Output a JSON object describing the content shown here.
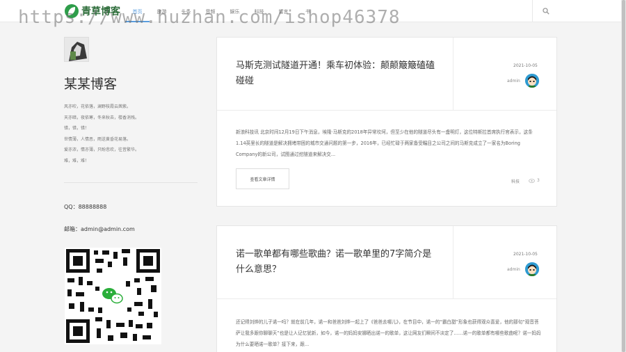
{
  "site": {
    "logo_text": "青草博客"
  },
  "nav": {
    "items": [
      "首页",
      "旅游",
      "头条",
      "音频",
      "娱乐",
      "科技",
      "留言",
      "书"
    ]
  },
  "icons": {
    "search": "search-icon",
    "views": "eye-icon",
    "logo": "leaf-logo-icon"
  },
  "colors": {
    "accent": "#5a9dde",
    "brand_green": "#2e9d4a"
  },
  "watermark": "https://www.huzhan.com/ishop46378",
  "sidebar": {
    "blog_title": "某某博客",
    "poem": [
      "风亦吹，花依落，澜野枝霞云茜紫。",
      "天亦暗，夜依寒，冬来秋去，楼香消残。",
      "错，错，错！",
      "世情薄，人情恶，雨送黄昏花易落。",
      "爱亦浓，情亦薄，只盼悲欢，往昔繁华。",
      "难，难，难！"
    ],
    "qq": "QQ：88888888",
    "email": "邮箱：admin@admin.com"
  },
  "posts": [
    {
      "title": "马斯克测试隧道开通！乘车初体验：颠颠簸簸磕磕碰碰",
      "date": "2021-10-05",
      "author": "admin",
      "excerpt": "新浪科技讯 北京时间12月19日下午消息，埃隆·马斯克的2018年异常坎坷，但至少在他的隧道尽头有一盏明灯，这位特斯拉首席执行官表示，这条1.14英里长的隧道是解决拥堵带困的城市交通问题的第一步，2016年，已经忙碌于两家备受瞩目之公司之间的马斯克成立了一家名为Boring Company的新公司，试图通过挖隧道来解决交...",
      "more": "查看文章详情",
      "category": "科技",
      "views": "3"
    },
    {
      "title": "诺一歌单都有哪些歌曲？诺一歌单里的7字简介是什么意思？",
      "date": "2021-10-05",
      "author": "admin",
      "excerpt": "还记得刘烨的儿子诺一吗？就在前几年，诺一和爸爸刘烨一起上了《爸爸去哪儿》，在节目中，诺一的“霸白甜”形象也获得观众喜爱，他的那句“观音菩萨让我多跟你聊聊天”也是让人记忆犹新，如今，诺一的妈妈安娜晒出诺一的歌单，这让网友们瞬间不淡定了……诺一的歌单都有哪些歌曲呢？诺一妈妈为什么要晒诺一歌单？接下来，跟..."
    }
  ]
}
